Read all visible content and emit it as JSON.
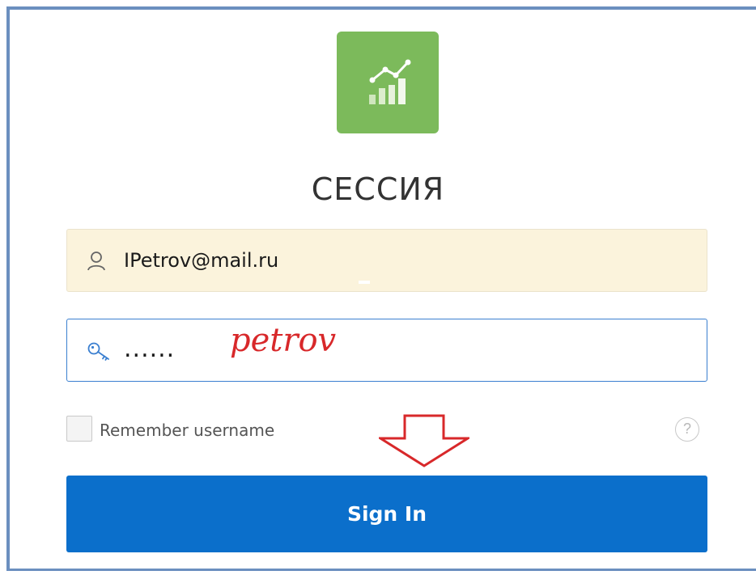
{
  "app": {
    "title": "СЕССИЯ"
  },
  "form": {
    "username": {
      "value": "IPetrov@mail.ru",
      "icon": "user-icon"
    },
    "password": {
      "value": "......",
      "icon": "key-icon"
    },
    "annotation": "petrov",
    "remember_label": "Remember username",
    "help_label": "?",
    "sign_in_label": "Sign In"
  },
  "colors": {
    "logo_bg": "#7cba5b",
    "username_bg": "#fbf3dc",
    "button_bg": "#0b6fcb",
    "annotation": "#d8282a",
    "focus_border": "#3a7fd0"
  },
  "icons": [
    "chart-logo-icon",
    "user-icon",
    "key-icon",
    "help-icon",
    "down-arrow-icon"
  ]
}
